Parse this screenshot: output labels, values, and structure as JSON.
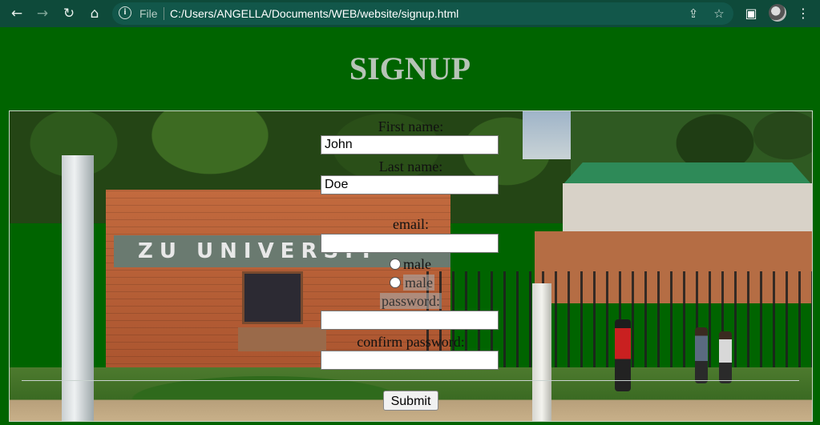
{
  "browser": {
    "url_scheme_label": "File",
    "url": "C:/Users/ANGELLA/Documents/WEB/website/signup.html",
    "icons": {
      "back": "back-arrow-icon",
      "forward": "forward-arrow-icon",
      "reload": "reload-icon",
      "home": "home-icon",
      "info": "info-icon",
      "share": "share-icon",
      "bookmark": "star-icon",
      "sidebar": "side-panel-icon",
      "profile": "avatar",
      "menu": "kebab-menu-icon"
    }
  },
  "page": {
    "title": "SIGNUP",
    "colors": {
      "background": "#006400",
      "title": "#b7c4b7"
    },
    "background_sign_text": "ZU UNIVERSIT"
  },
  "form": {
    "first_name_label": "First name:",
    "first_name_value": "John",
    "last_name_label": "Last name:",
    "last_name_value": "Doe",
    "email_label": "email:",
    "email_value": "",
    "gender_option_1": "male",
    "gender_option_2": "male",
    "password_label": "password:",
    "password_value": "",
    "confirm_password_label": "confirm password:",
    "confirm_password_value": "",
    "submit_label": "Submit"
  }
}
